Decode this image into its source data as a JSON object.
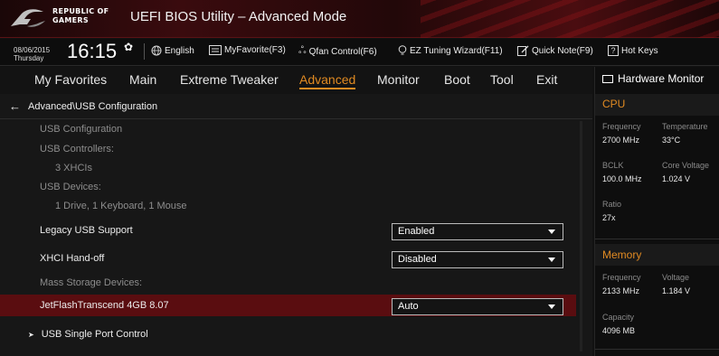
{
  "window": {
    "brand_line1": "REPUBLIC OF",
    "brand_line2": "GAMERS",
    "title": "UEFI BIOS Utility – Advanced Mode"
  },
  "infobar": {
    "date": "08/06/2015",
    "day": "Thursday",
    "time": "16:15",
    "tools": [
      {
        "icon": "globe-icon",
        "label": "English"
      },
      {
        "icon": "favorite-list-icon",
        "label": "MyFavorite(F3)"
      },
      {
        "icon": "fan-icon",
        "label": "Qfan Control(F6)"
      },
      {
        "icon": "lightbulb-icon",
        "label": "EZ Tuning Wizard(F11)"
      },
      {
        "icon": "note-icon",
        "label": "Quick Note(F9)"
      },
      {
        "icon": "help-icon",
        "label": "Hot Keys"
      }
    ]
  },
  "nav": {
    "tabs": [
      "My Favorites",
      "Main",
      "Extreme Tweaker",
      "Advanced",
      "Monitor",
      "Boot",
      "Tool",
      "Exit"
    ],
    "active": "Advanced"
  },
  "main": {
    "breadcrumb": "Advanced\\USB Configuration",
    "usb_config_label": "USB Configuration",
    "controllers_label": "USB Controllers:",
    "controllers_value": "3 XHCIs",
    "devices_label": "USB Devices:",
    "devices_value": "1 Drive, 1 Keyboard, 1 Mouse",
    "legacy_label": "Legacy USB Support",
    "legacy_value": "Enabled",
    "xhci_label": "XHCI Hand-off",
    "xhci_value": "Disabled",
    "mass_storage_label": "Mass Storage Devices:",
    "drive_label": "JetFlashTranscend 4GB 8.07",
    "drive_value": "Auto",
    "single_port_label": "USB Single Port Control"
  },
  "hw_monitor": {
    "title": "Hardware Monitor",
    "cpu": {
      "section": "CPU",
      "frequency_label": "Frequency",
      "frequency": "2700 MHz",
      "temperature_label": "Temperature",
      "temperature": "33°C",
      "bclk_label": "BCLK",
      "bclk": "100.0 MHz",
      "core_voltage_label": "Core Voltage",
      "core_voltage": "1.024 V",
      "ratio_label": "Ratio",
      "ratio": "27x"
    },
    "memory": {
      "section": "Memory",
      "frequency_label": "Frequency",
      "frequency": "2133 MHz",
      "voltage_label": "Voltage",
      "voltage": "1.184 V",
      "capacity_label": "Capacity",
      "capacity": "4096 MB"
    }
  },
  "colors": {
    "accent": "#e08a22",
    "selection": "#5a0d10",
    "title_red": "#3a0b0e"
  }
}
